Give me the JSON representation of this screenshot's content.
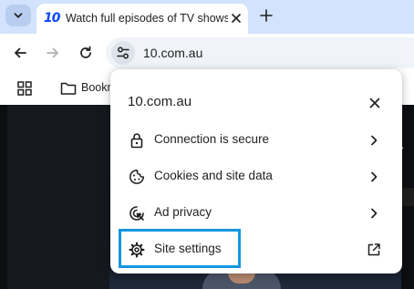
{
  "tabstrip": {
    "search_icon": "chevron-down-icon",
    "active_tab": {
      "favicon_text": "10",
      "title": "Watch full episodes of TV shows",
      "close_icon": "close-icon"
    },
    "new_tab_icon": "plus-icon"
  },
  "toolbar": {
    "back_icon": "arrow-left-icon",
    "forward_icon": "arrow-right-icon",
    "reload_icon": "reload-icon",
    "site_info_icon": "tune-icon",
    "url": "10.com.au"
  },
  "bookmarks": {
    "apps_icon": "apps-grid-icon",
    "folder_icon": "folder-icon",
    "label": "Bookmarks"
  },
  "popup": {
    "title": "10.com.au",
    "items": [
      {
        "label": "Connection is secure",
        "icon": "lock-icon",
        "trailing_icon": "chevron-right-icon"
      },
      {
        "label": "Cookies and site data",
        "icon": "cookie-icon",
        "trailing_icon": "chevron-right-icon"
      },
      {
        "label": "Ad privacy",
        "icon": "ad-privacy-icon",
        "trailing_icon": "chevron-right-icon"
      },
      {
        "label": "Site settings",
        "icon": "gear-icon",
        "trailing_icon": "open-external-icon"
      }
    ]
  },
  "colors": {
    "tabstrip_bg": "#d3e3fd",
    "omnibox_bg": "#f0f4f9",
    "brand_blue": "#0a47ff",
    "highlight": "#1597e0",
    "page_bg": "#0c0e12"
  }
}
